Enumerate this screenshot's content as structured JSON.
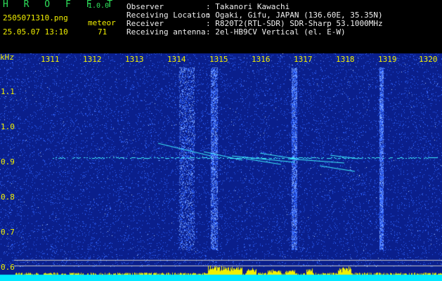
{
  "header": {
    "app_title": "H R O F F T",
    "app_version": "1.0.0",
    "file_name": "2505071310.png",
    "datetime": "25.05.07 13:10",
    "meteor_label": "meteor",
    "meteor_count": "71",
    "info": [
      {
        "label": "Observer",
        "value": ": Takanori Kawachi"
      },
      {
        "label": "Receiving Location",
        "value": ": Ogaki, Gifu, JAPAN (136.60E, 35.35N)"
      },
      {
        "label": "Receiver",
        "value": ": R820T2(RTL-SDR) SDR-Sharp 53.1000MHz"
      },
      {
        "label": "Receiving antenna",
        "value": ": 2el-HB9CV Vertical (el. E-W)"
      }
    ]
  },
  "plot": {
    "unit": "kHz",
    "time_ticks": [
      "1311",
      "1312",
      "1313",
      "1314",
      "1315",
      "1316",
      "1317",
      "1318",
      "1319",
      "1320"
    ],
    "freq_ticks": [
      "1.1",
      "1.0",
      "0.9",
      "0.8",
      "0.7",
      "0.6"
    ],
    "colors": {
      "background": "#0a1f8c",
      "noise": "#2e63ff",
      "signal": "#3ff0ff",
      "activity": "#f2f000",
      "bar": "#00e8ff"
    }
  }
}
